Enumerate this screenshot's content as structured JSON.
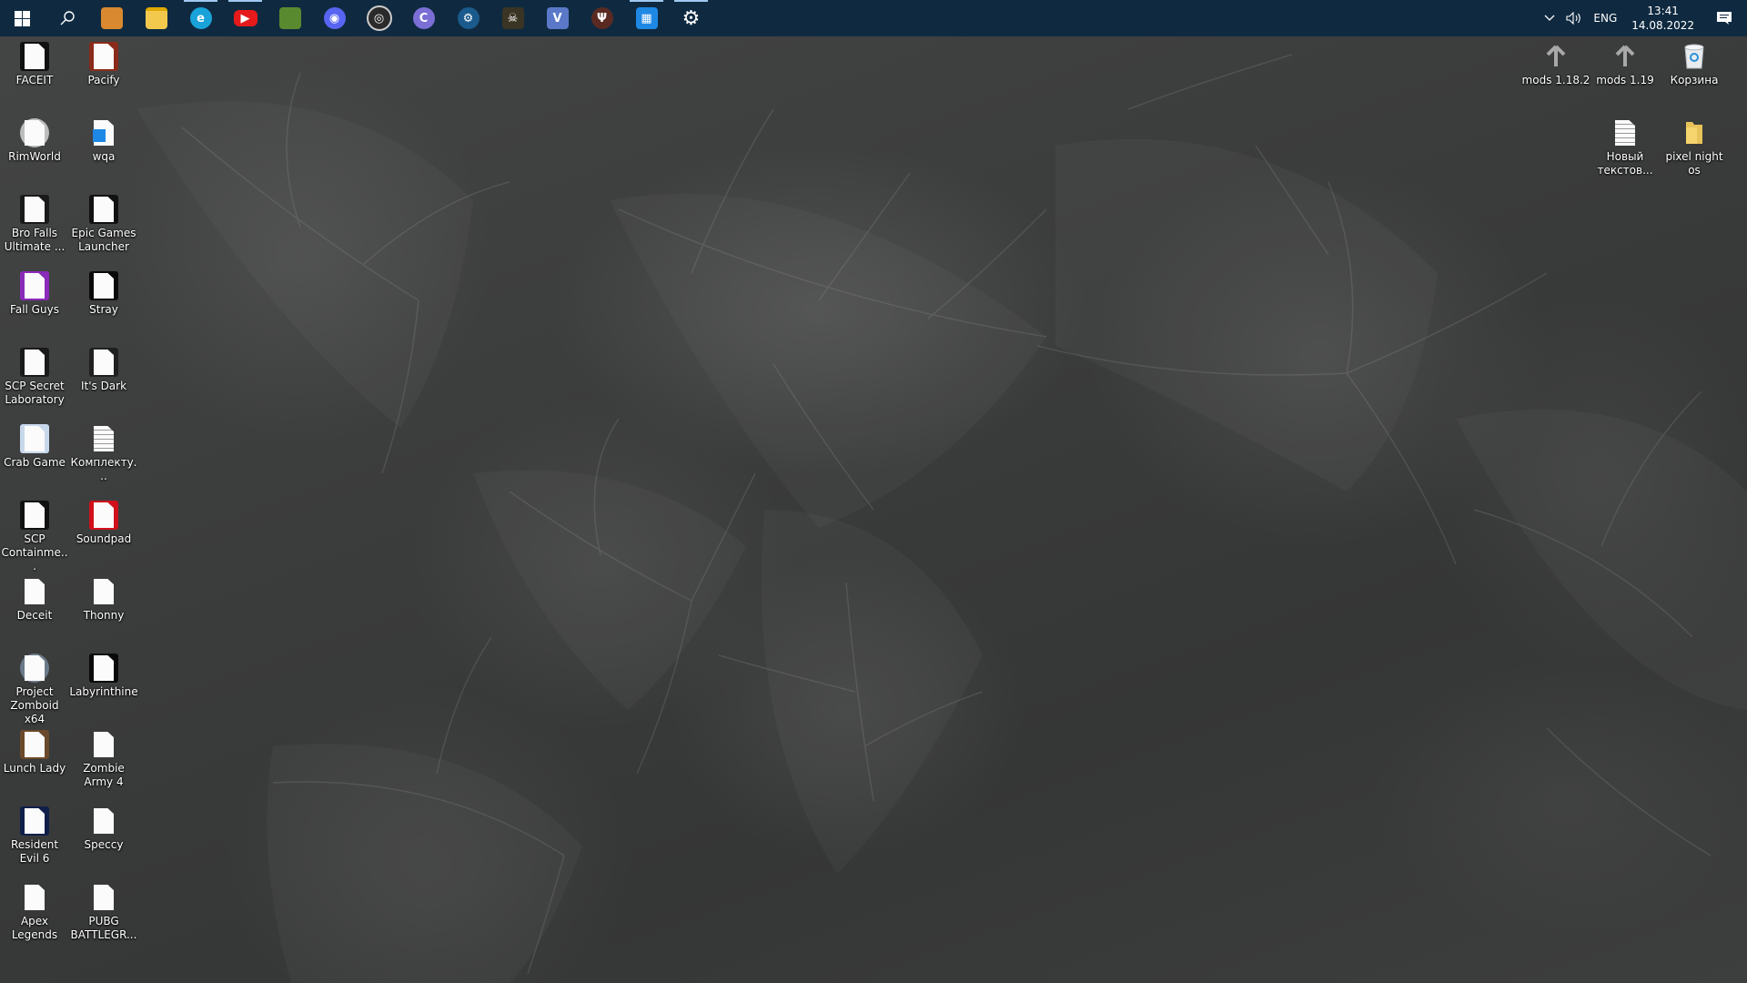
{
  "taskbar": {
    "start_icon": "windows-start-icon",
    "search_icon": "search-icon",
    "pinned": [
      {
        "name": "winrar",
        "icon": "archive-icon",
        "color": "#d9892f",
        "glyph": "",
        "active": false
      },
      {
        "name": "file-explorer",
        "icon": "folder-icon",
        "color": "#f2c94c",
        "glyph": "",
        "active": false
      },
      {
        "name": "microsoft-edge",
        "icon": "edge-icon",
        "color": "#1aa3d9",
        "glyph": "e",
        "active": true
      },
      {
        "name": "youtube",
        "icon": "youtube-icon",
        "color": "#e51a1a",
        "glyph": "▶",
        "active": true
      },
      {
        "name": "minecraft",
        "icon": "grass-block-icon",
        "color": "#5a8a2f",
        "glyph": "",
        "active": false
      },
      {
        "name": "discord",
        "icon": "discord-icon",
        "color": "#5865f2",
        "glyph": "◉",
        "active": false
      },
      {
        "name": "obs-studio",
        "icon": "obs-icon",
        "color": "#2a2a2a",
        "glyph": "◎",
        "active": false
      },
      {
        "name": "bittorrent",
        "icon": "torrent-icon",
        "color": "#7b6fd6",
        "glyph": "C",
        "active": false
      },
      {
        "name": "steam",
        "icon": "steam-icon",
        "color": "#1b5a8c",
        "glyph": "⚙",
        "active": false
      },
      {
        "name": "skull-game",
        "icon": "skull-icon",
        "color": "#3a3424",
        "glyph": "☠",
        "active": false
      },
      {
        "name": "v-app",
        "icon": "v-icon",
        "color": "#5b78c8",
        "glyph": "V",
        "active": false
      },
      {
        "name": "jedi-app",
        "icon": "jedi-order-icon",
        "color": "#5a2a22",
        "glyph": "Ψ",
        "active": false
      },
      {
        "name": "registry-editor",
        "icon": "registry-cubes-icon",
        "color": "#1e88e5",
        "glyph": "▦",
        "active": true
      },
      {
        "name": "settings",
        "icon": "gear-icon",
        "color": "transparent",
        "glyph": "⚙",
        "active": true
      }
    ],
    "tray": {
      "chevron_icon": "chevron-up-icon",
      "volume_icon": "speaker-icon",
      "language": "ENG",
      "time": "13:41",
      "date": "14.08.2022",
      "notification_icon": "action-center-icon"
    }
  },
  "desktop": {
    "left_icons": [
      {
        "label": "FACEIT",
        "icon": "faceit-shortcut-icon",
        "bg": "#111111"
      },
      {
        "label": "Pacify",
        "icon": "pacify-shortcut-icon",
        "bg": "#8a2a1a"
      },
      {
        "label": "RimWorld",
        "icon": "rimworld-shortcut-icon",
        "bg": "#bdbdbd"
      },
      {
        "label": "wqa",
        "icon": "registry-file-icon",
        "bg": ""
      },
      {
        "label": "Bro Falls Ultimate ...",
        "icon": "bro-falls-shortcut-icon",
        "bg": "#1a1a1a"
      },
      {
        "label": "Epic Games Launcher",
        "icon": "epic-games-shortcut-icon",
        "bg": "#111111"
      },
      {
        "label": "Fall Guys",
        "icon": "fall-guys-shortcut-icon",
        "bg": "#8a2ab8"
      },
      {
        "label": "Stray",
        "icon": "stray-shortcut-icon",
        "bg": "#0a0a0a"
      },
      {
        "label": "SCP Secret Laboratory",
        "icon": "scp-sl-shortcut-icon",
        "bg": "#1a1a1a"
      },
      {
        "label": "It's Dark",
        "icon": "its-dark-shortcut-icon",
        "bg": "#202020"
      },
      {
        "label": "Crab Game",
        "icon": "crab-game-shortcut-icon",
        "bg": "#c8d8ec"
      },
      {
        "label": "Комплекту...",
        "icon": "text-document-icon",
        "bg": ""
      },
      {
        "label": "SCP Containme...",
        "icon": "scp-containment-shortcut-icon",
        "bg": "#111111"
      },
      {
        "label": "Soundpad",
        "icon": "soundpad-shortcut-icon",
        "bg": "#d0101a"
      },
      {
        "label": "Deceit",
        "icon": "deceit-shortcut-icon",
        "bg": ""
      },
      {
        "label": "Thonny",
        "icon": "thonny-shortcut-icon",
        "bg": ""
      },
      {
        "label": "Project Zomboid x64",
        "icon": "project-zomboid-shortcut-icon",
        "bg": "#6a7a8a"
      },
      {
        "label": "Labyrinthine",
        "icon": "labyrinthine-shortcut-icon",
        "bg": "#0a0a0a"
      },
      {
        "label": "Lunch Lady",
        "icon": "lunch-lady-shortcut-icon",
        "bg": "#6a4a2a"
      },
      {
        "label": "Zombie Army 4",
        "icon": "zombie-army-shortcut-icon",
        "bg": ""
      },
      {
        "label": "Resident Evil 6",
        "icon": "resident-evil-shortcut-icon",
        "bg": "#0f1f4a"
      },
      {
        "label": "Speccy",
        "icon": "speccy-shortcut-icon",
        "bg": ""
      },
      {
        "label": "Apex Legends",
        "icon": "apex-legends-shortcut-icon",
        "bg": ""
      },
      {
        "label": "PUBG BATTLEGR...",
        "icon": "pubg-shortcut-icon",
        "bg": ""
      }
    ],
    "right_icons": [
      {
        "label": "mods 1.18.2",
        "icon": "upload-arrow-icon"
      },
      {
        "label": "mods 1.19",
        "icon": "upload-arrow-icon"
      },
      {
        "label": "Корзина",
        "icon": "recycle-bin-icon"
      },
      {
        "label": "Новый текстов...",
        "icon": "text-document-icon"
      },
      {
        "label": "pixel night os",
        "icon": "folder-icon"
      }
    ]
  }
}
